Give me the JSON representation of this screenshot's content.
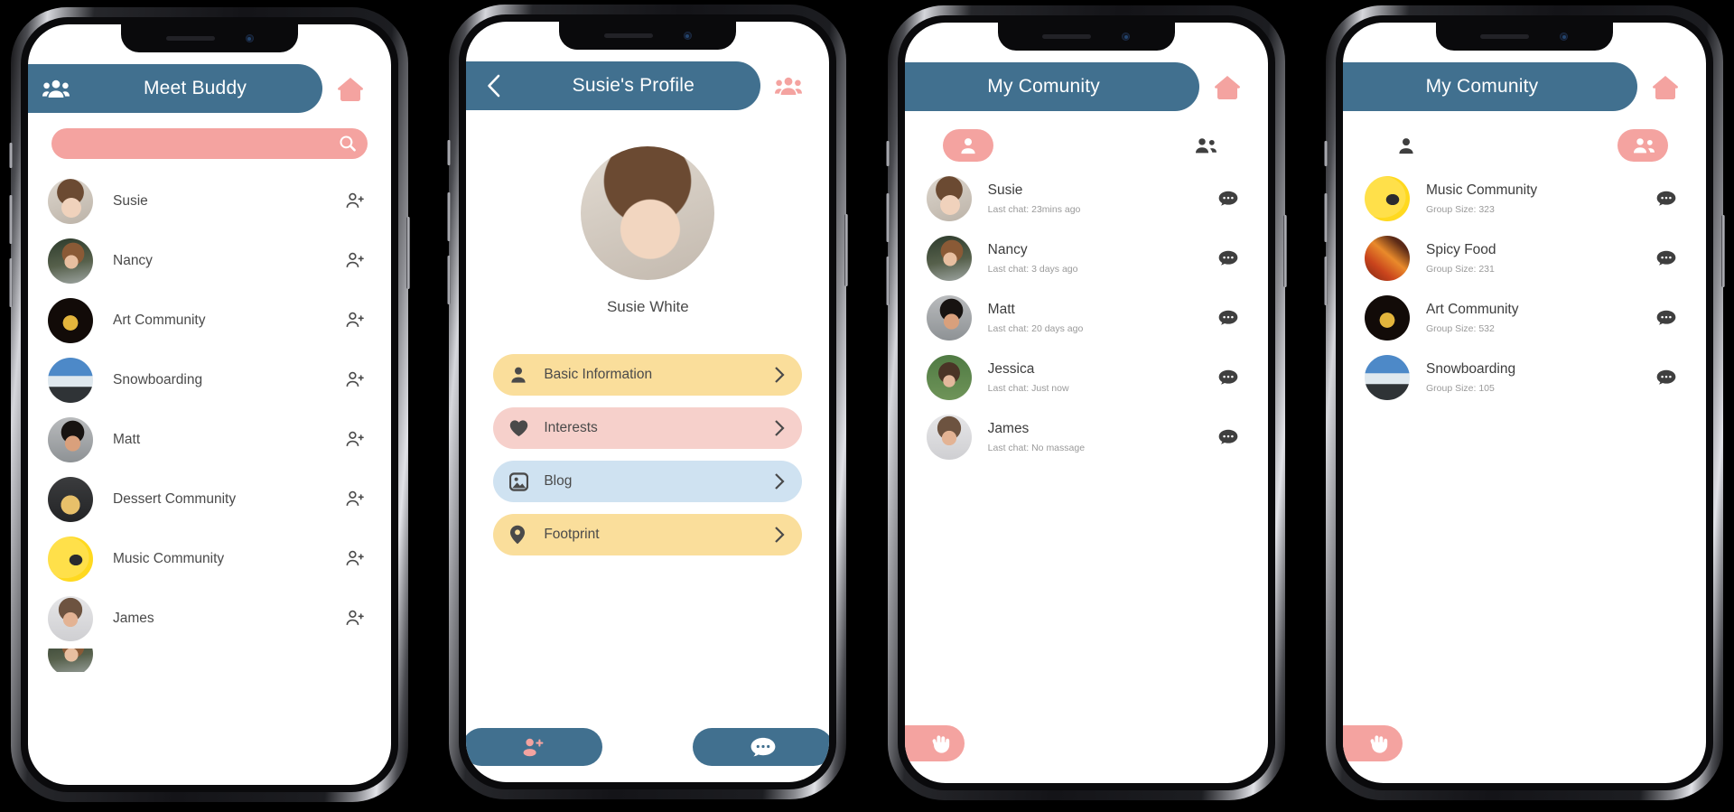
{
  "colors": {
    "header_blue": "#41708f",
    "accent_pink": "#f4a3a0",
    "yellow": "#fade9b",
    "pink_soft": "#f6d0cb",
    "blue_soft": "#cfe2f1",
    "text_dark": "#4a4a4a",
    "text_muted": "#9a9a9a"
  },
  "screen1": {
    "header": {
      "title": "Meet Buddy",
      "lead_icon": "group-people-icon",
      "home_icon": "home-icon"
    },
    "search": {
      "value": "",
      "placeholder": "",
      "icon": "search-icon"
    },
    "list": [
      {
        "name": "Susie",
        "avatar": "av-susie",
        "action_icon": "add-person-icon"
      },
      {
        "name": "Nancy",
        "avatar": "av-nancy",
        "action_icon": "add-person-icon"
      },
      {
        "name": "Art Community",
        "avatar": "av-art",
        "action_icon": "add-person-icon"
      },
      {
        "name": "Snowboarding",
        "avatar": "av-snow",
        "action_icon": "add-person-icon"
      },
      {
        "name": "Matt",
        "avatar": "av-matt",
        "action_icon": "add-person-icon"
      },
      {
        "name": "Dessert Community",
        "avatar": "av-dessert",
        "action_icon": "add-person-icon"
      },
      {
        "name": "Music Community",
        "avatar": "av-music",
        "action_icon": "add-person-icon"
      },
      {
        "name": "James",
        "avatar": "av-james",
        "action_icon": "add-person-icon"
      }
    ]
  },
  "screen2": {
    "header": {
      "title": "Susie's Profile",
      "back_icon": "chevron-left-icon",
      "group_icon": "group-people-icon"
    },
    "profile": {
      "name": "Susie White",
      "avatar": "profile-photo"
    },
    "menu": [
      {
        "label": "Basic Information",
        "icon": "person-icon",
        "color": "#fade9b",
        "chevron": "chevron-right-icon"
      },
      {
        "label": "Interests",
        "icon": "heart-icon",
        "color": "#f6d0cb",
        "chevron": "chevron-right-icon"
      },
      {
        "label": "Blog",
        "icon": "image-icon",
        "color": "#cfe2f1",
        "chevron": "chevron-right-icon"
      },
      {
        "label": "Footprint",
        "icon": "location-pin-icon",
        "color": "#fade9b",
        "chevron": "chevron-right-icon"
      }
    ],
    "bottom": {
      "left_icon": "add-friend-icon",
      "right_icon": "chat-bubble-icon"
    }
  },
  "screen3": {
    "header": {
      "title": "My Comunity",
      "home_icon": "home-icon"
    },
    "tabs": [
      {
        "icon": "person-icon",
        "active": true,
        "name": "friends-tab"
      },
      {
        "icon": "group-people-icon",
        "active": false,
        "name": "groups-tab"
      }
    ],
    "list": [
      {
        "name": "Susie",
        "sub": "Last chat: 23mins ago",
        "avatar": "av-susie",
        "action_icon": "chat-bubble-icon"
      },
      {
        "name": "Nancy",
        "sub": "Last chat: 3 days ago",
        "avatar": "av-nancy",
        "action_icon": "chat-bubble-icon"
      },
      {
        "name": "Matt",
        "sub": "Last chat: 20 days ago",
        "avatar": "av-matt",
        "action_icon": "chat-bubble-icon"
      },
      {
        "name": "Jessica",
        "sub": "Last chat: Just now",
        "avatar": "av-jessica",
        "action_icon": "chat-bubble-icon"
      },
      {
        "name": "James",
        "sub": "Last chat: No massage",
        "avatar": "av-james",
        "action_icon": "chat-bubble-icon"
      }
    ],
    "fab": {
      "icon": "wave-hand-icon"
    }
  },
  "screen4": {
    "header": {
      "title": "My Comunity",
      "home_icon": "home-icon"
    },
    "tabs": [
      {
        "icon": "person-icon",
        "active": false,
        "name": "friends-tab"
      },
      {
        "icon": "group-people-icon",
        "active": true,
        "name": "groups-tab"
      }
    ],
    "list": [
      {
        "name": "Music Community",
        "sub": "Group Size: 323",
        "avatar": "av-music",
        "action_icon": "chat-bubble-icon"
      },
      {
        "name": "Spicy Food",
        "sub": "Group Size: 231",
        "avatar": "av-spicy",
        "action_icon": "chat-bubble-icon"
      },
      {
        "name": "Art Community",
        "sub": "Group Size: 532",
        "avatar": "av-art",
        "action_icon": "chat-bubble-icon"
      },
      {
        "name": "Snowboarding",
        "sub": "Group Size: 105",
        "avatar": "av-snow",
        "action_icon": "chat-bubble-icon"
      }
    ],
    "fab": {
      "icon": "wave-hand-icon"
    }
  }
}
